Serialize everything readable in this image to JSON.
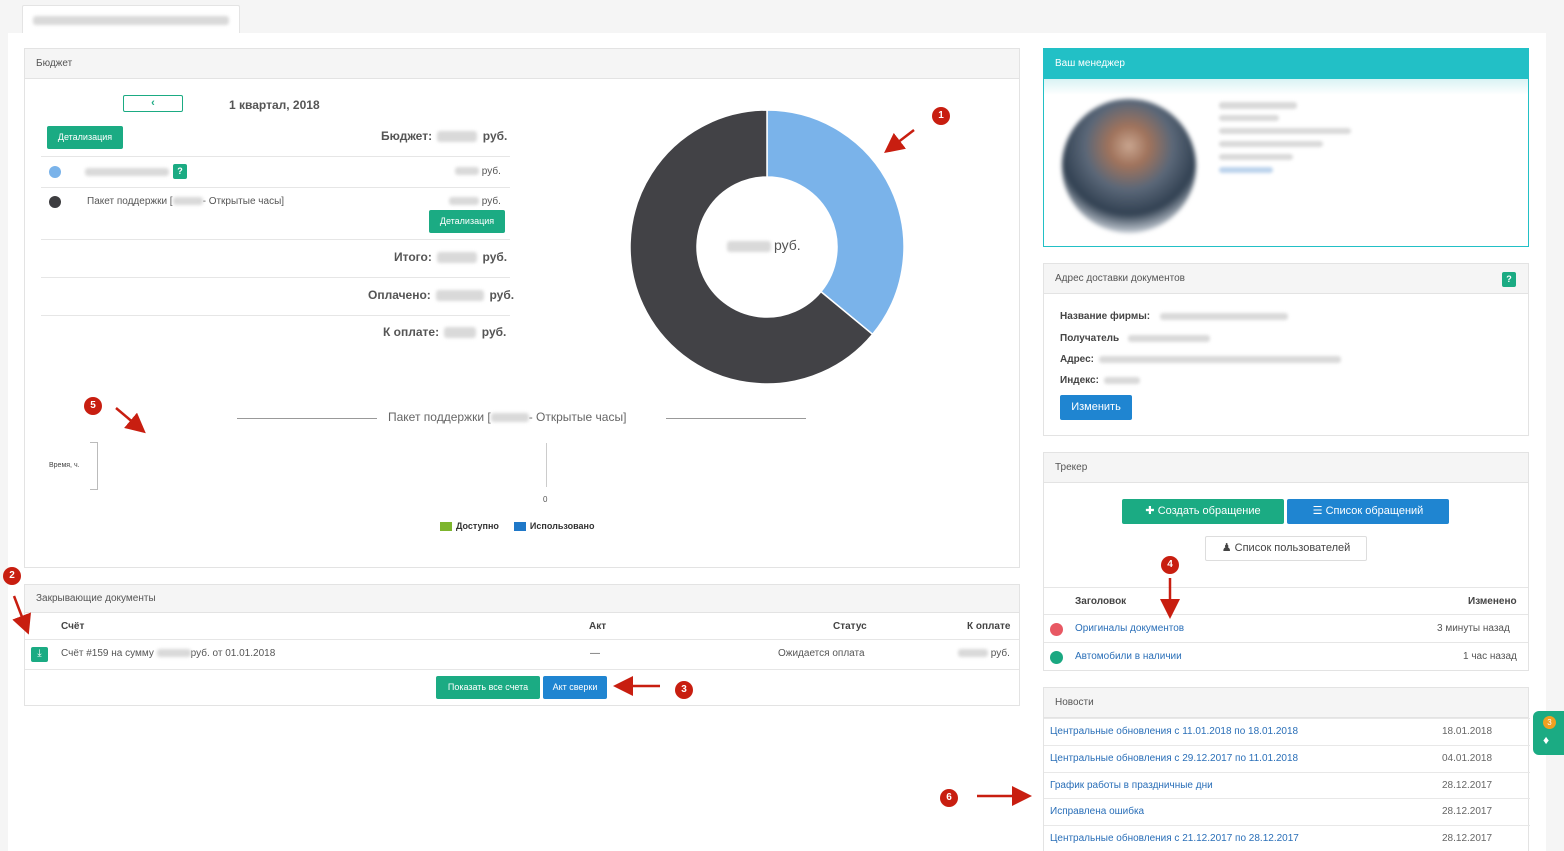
{
  "budget": {
    "title": "Бюджет",
    "period": "1 квартал, 2018",
    "detail_label": "Детализация",
    "budget_label": "Бюджет:",
    "currency": "руб.",
    "item2_name_start": "Пакет поддержки [",
    "item2_name_end": "- Открытые часы]",
    "total_label": "Итого:",
    "paid_label": "Оплачено:",
    "topay_label": "К оплате:",
    "item_colors": [
      "#7ab3ea",
      "#3d3d40"
    ],
    "item_help": "?"
  },
  "chart_data": {
    "type": "pie",
    "slices": [
      {
        "color": "#7ab3ea",
        "value": 36
      },
      {
        "color": "#424246",
        "value": 64
      }
    ],
    "center_unit": "руб."
  },
  "support_chart": {
    "title_start": "Пакет поддержки [",
    "title_end": "- Открытые часы]",
    "ylabel": "Время, ч.",
    "tick": "0",
    "legend": [
      {
        "label": "Доступно",
        "color": "#7db52d"
      },
      {
        "label": "Использовано",
        "color": "#1f78c8"
      }
    ]
  },
  "docs": {
    "title": "Закрывающие документы",
    "columns": [
      "Счёт",
      "Акт",
      "Статус",
      "К оплате"
    ],
    "row": {
      "invoice_start": "Счёт #159 на сумму",
      "invoice_end": "руб. от 01.01.2018",
      "act": "—",
      "status": "Ожидается оплата",
      "currency": "руб."
    },
    "show_all": "Показать все счета",
    "reconcile": "Акт сверки"
  },
  "manager": {
    "title": "Ваш менеджер"
  },
  "address": {
    "title": "Адрес доставки документов",
    "help": "?",
    "labels": [
      "Название фирмы:",
      "Получатель",
      "Адрес:",
      "Индекс:"
    ],
    "edit": "Изменить"
  },
  "tracker": {
    "title": "Трекер",
    "create": "Создать обращение",
    "list": "Список обращений",
    "users": "Список пользователей",
    "col_title": "Заголовок",
    "col_changed": "Изменено",
    "rows": [
      {
        "title": "Оригиналы документов",
        "changed": "3 минуты назад",
        "color": "#e85863"
      },
      {
        "title": "Автомобили в наличии",
        "changed": "1 час назад",
        "color": "#1aa881"
      }
    ]
  },
  "news": {
    "title": "Новости",
    "items": [
      {
        "title": "Центральные обновления с 11.01.2018 по 18.01.2018",
        "date": "18.01.2018"
      },
      {
        "title": "Центральные обновления с 29.12.2017 по 11.01.2018",
        "date": "04.01.2018"
      },
      {
        "title": "График работы в праздничные дни",
        "date": "28.12.2017"
      },
      {
        "title": "Исправлена ошибка",
        "date": "28.12.2017"
      },
      {
        "title": "Центральные обновления с 21.12.2017 по 28.12.2017",
        "date": "28.12.2017"
      }
    ]
  },
  "notifications": {
    "count": "3"
  },
  "markers": [
    "1",
    "2",
    "3",
    "4",
    "5",
    "6"
  ]
}
